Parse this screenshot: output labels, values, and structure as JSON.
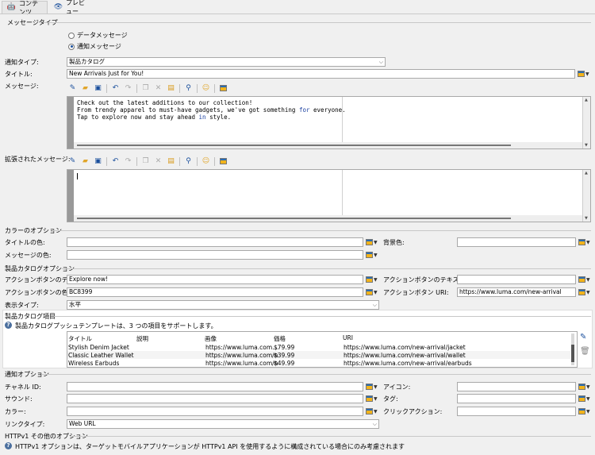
{
  "tabs": [
    {
      "label": "コンテンツ",
      "icon": "android-icon"
    },
    {
      "label": "プレビュー",
      "icon": "eye-icon"
    }
  ],
  "message_type": {
    "title": "メッセージタイプ",
    "options": [
      {
        "label": "データメッセージ",
        "selected": false
      },
      {
        "label": "通知メッセージ",
        "selected": true
      }
    ]
  },
  "notification_type": {
    "label": "通知タイプ:",
    "value": "製品カタログ"
  },
  "title_field": {
    "label": "タイトル:",
    "value": "New Arrivals Just for You!"
  },
  "message": {
    "label": "メッセージ:",
    "lines": [
      "Check out the latest additions to our collection!",
      "From trendy apparel to must-have gadgets, we've got something for everyone.",
      "Tap to explore now and stay ahead in style."
    ],
    "keywords": [
      "for",
      "in"
    ]
  },
  "extended_message": {
    "label": "拡張されたメッセージ:",
    "value": ""
  },
  "toolbar": {
    "icons": [
      "insert-field-icon",
      "open-folder-icon",
      "save-icon",
      "undo-icon",
      "redo-icon",
      "copy-icon",
      "delete-icon",
      "paste-icon",
      "find-icon",
      "emoji-icon",
      "picker-icon"
    ]
  },
  "color_options": {
    "title": "カラーのオプション",
    "title_color": {
      "label": "タイトルの色:",
      "value": ""
    },
    "background_color": {
      "label": "背景色:",
      "value": ""
    },
    "message_color": {
      "label": "メッセージの色:",
      "value": ""
    }
  },
  "catalog_options": {
    "title": "製品カタログオプション",
    "action_button_text": {
      "label": "アクションボタンのテキスト:",
      "value": "Explore now!"
    },
    "action_button_text_color": {
      "label": "アクションボタンのテキストの色:",
      "value": ""
    },
    "action_button_color": {
      "label": "アクションボタンの色:",
      "value": "BC8399"
    },
    "action_button_uri": {
      "label": "アクションボタン URI:",
      "value": "https://www.luma.com/new-arrival"
    },
    "display_type": {
      "label": "表示タイプ:",
      "value": "水平"
    }
  },
  "catalog_items": {
    "title": "製品カタログ項目",
    "info": "製品カタログプッシュテンプレートは、3 つの項目をサポートします。",
    "columns": [
      "タイトル",
      "説明",
      "画像",
      "価格",
      "URI"
    ],
    "rows": [
      {
        "title": "Stylish Denim Jacket",
        "desc": "",
        "image": "https://www.luma.com...",
        "price": "$79.99",
        "uri": "https://www.luma.com/new-arrival/jacket"
      },
      {
        "title": "Classic Leather Wallet",
        "desc": "",
        "image": "https://www.luma.com/n",
        "price": "$39.99",
        "uri": "https://www.luma.com/new-arrival/wallet"
      },
      {
        "title": "Wireless Earbuds",
        "desc": "",
        "image": "https://www.luma.com/n",
        "price": "$49.99",
        "uri": "https://www.luma.com/new-arrival/earbuds"
      }
    ]
  },
  "notification_options": {
    "title": "通知オプション",
    "channel_id": {
      "label": "チャネル ID:",
      "value": ""
    },
    "icon": {
      "label": "アイコン:",
      "value": ""
    },
    "sound": {
      "label": "サウンド:",
      "value": ""
    },
    "tag": {
      "label": "タグ:",
      "value": ""
    },
    "color": {
      "label": "カラー:",
      "value": ""
    },
    "click_action": {
      "label": "クリックアクション:",
      "value": ""
    },
    "link_type": {
      "label": "リンクタイプ:",
      "value": "Web URL"
    }
  },
  "httpv1": {
    "title": "HTTPv1 その他のオプション",
    "info": "HTTPv1 オプションは、ターゲットモバイルアプリケーションが HTTPv1 API を使用するように構成されている場合にのみ考慮されます"
  }
}
